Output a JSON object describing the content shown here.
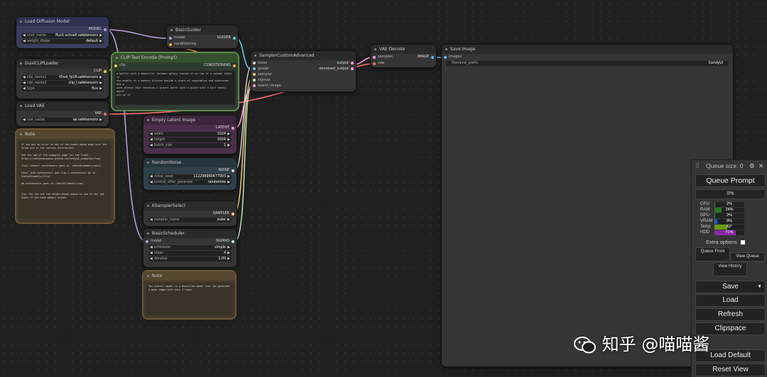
{
  "nodes": {
    "load_diffusion": {
      "title": "Load Diffusion Model",
      "output": "MODEL",
      "unet_name_label": "unet_name",
      "unet_name_value": "flux1-schnell.safetensors",
      "weight_dtype_label": "weight_dtype",
      "weight_dtype_value": "default"
    },
    "dual_clip": {
      "title": "DualCLIPLoader",
      "output": "CLIP",
      "clip_name1_label": "clip_name1",
      "clip_name1_value": "t5xxl_fp16.safetensors",
      "clip_name2_label": "clip_name2",
      "clip_name2_value": "clip_l.safetensors",
      "type_label": "type",
      "type_value": "flux"
    },
    "load_vae": {
      "title": "Load VAE",
      "output": "VAE",
      "vae_name_label": "vae_name",
      "vae_name_value": "ae.safetensors"
    },
    "note1": {
      "title": "Note",
      "text": "If you get an error in any of the nodes above make sure the\nfiles are in the correct directories.\n\nSee the top of the examples page for the links :\nhttps://comfyanonymous.github.io/ComfyUI_examples/flux/\n\nflux1-schnell.safetensors goes in: ComfyUI/models/unet/\n\nt5xxl_fp16.safetensors and clip_l.safetensors go in:\nComfyUI/models/clip/\n\nae.safetensors goes in: ComfyUI/models/vae/\n\n\nTip: You can set the weight_dtype above to one of the fp8\ntypes if you have memory issues."
    },
    "basic_guider": {
      "title": "BasicGuider",
      "in1": "model",
      "in2": "conditioning",
      "output": "GUIDER"
    },
    "clip_encode": {
      "title": "CLIP Text Encode (Prompt)",
      "input": "clip",
      "output": "CONDITIONING",
      "text": "a bottle with a beautiful rainbow galaxy inside it on top of a wooden table in\nthe middle of a modern kitchen beside a plate of vegetables and mushrooms and a\nwine glasse that contains a planet earth with a plate with a half eaten apple\npie on it"
    },
    "empty_latent": {
      "title": "Empty Latent Image",
      "output": "LATENT",
      "width_label": "width",
      "width_value": "1024",
      "height_label": "height",
      "height_value": "1024",
      "batch_label": "batch_size",
      "batch_value": "1"
    },
    "random_noise": {
      "title": "RandomNoise",
      "output": "NOISE",
      "seed_label": "noise_seed",
      "seed_value": "112298990477003",
      "control_label": "control_after_generate",
      "control_value": "randomize"
    },
    "ksampler_select": {
      "title": "KSamplerSelect",
      "output": "SAMPLER",
      "sampler_label": "sampler_name",
      "sampler_value": "euler"
    },
    "basic_scheduler": {
      "title": "BasicScheduler",
      "input": "model",
      "output": "SIGMAS",
      "scheduler_label": "scheduler",
      "scheduler_value": "simple",
      "steps_label": "steps",
      "steps_value": "4",
      "denoise_label": "denoise",
      "denoise_value": "1.00"
    },
    "note2": {
      "title": "Note",
      "text": "The schnell model is a distilled model that can generate\na good image with only 4 steps."
    },
    "sampler_adv": {
      "title": "SamplerCustomAdvanced",
      "in_noise": "noise",
      "in_guider": "guider",
      "in_sampler": "sampler",
      "in_sigmas": "sigmas",
      "in_latent": "latent_image",
      "out1": "output",
      "out2": "denoised_output"
    },
    "vae_decode": {
      "title": "VAE Decode",
      "in_samples": "samples",
      "in_vae": "vae",
      "output": "IMAGE"
    },
    "save_image": {
      "title": "Save Image",
      "input": "images",
      "prefix_label": "filename_prefix",
      "prefix_value": "ComfyUI"
    }
  },
  "panel": {
    "queue_size": "Queue size: 0",
    "queue_prompt": "Queue Prompt",
    "progress": "0%",
    "stats": [
      {
        "label": "CPU",
        "value": "2%",
        "level": 0.02,
        "color": "#2a8a2a"
      },
      {
        "label": "RAM",
        "value": "24%",
        "level": 0.24,
        "color": "#1a7a1a"
      },
      {
        "label": "GPU",
        "value": "2%",
        "level": 0.02,
        "color": "#2a8a2a"
      },
      {
        "label": "VRAM",
        "value": "9%",
        "level": 0.09,
        "color": "#2255cc"
      },
      {
        "label": "Temp",
        "value": "43°",
        "level": 0.43,
        "color": "#6a9a10"
      },
      {
        "label": "HDD",
        "value": "71%",
        "level": 0.71,
        "color": "#8a2aa8"
      }
    ],
    "extra_options": "Extra options",
    "queue_front": "Queue Front",
    "view_queue": "View Queue",
    "view_history": "View History",
    "save": "Save",
    "load": "Load",
    "refresh": "Refresh",
    "clipspace": "Clipspace",
    "load_default": "Load Default",
    "reset_view": "Reset View"
  },
  "watermark": "知乎 @喵喵酱"
}
